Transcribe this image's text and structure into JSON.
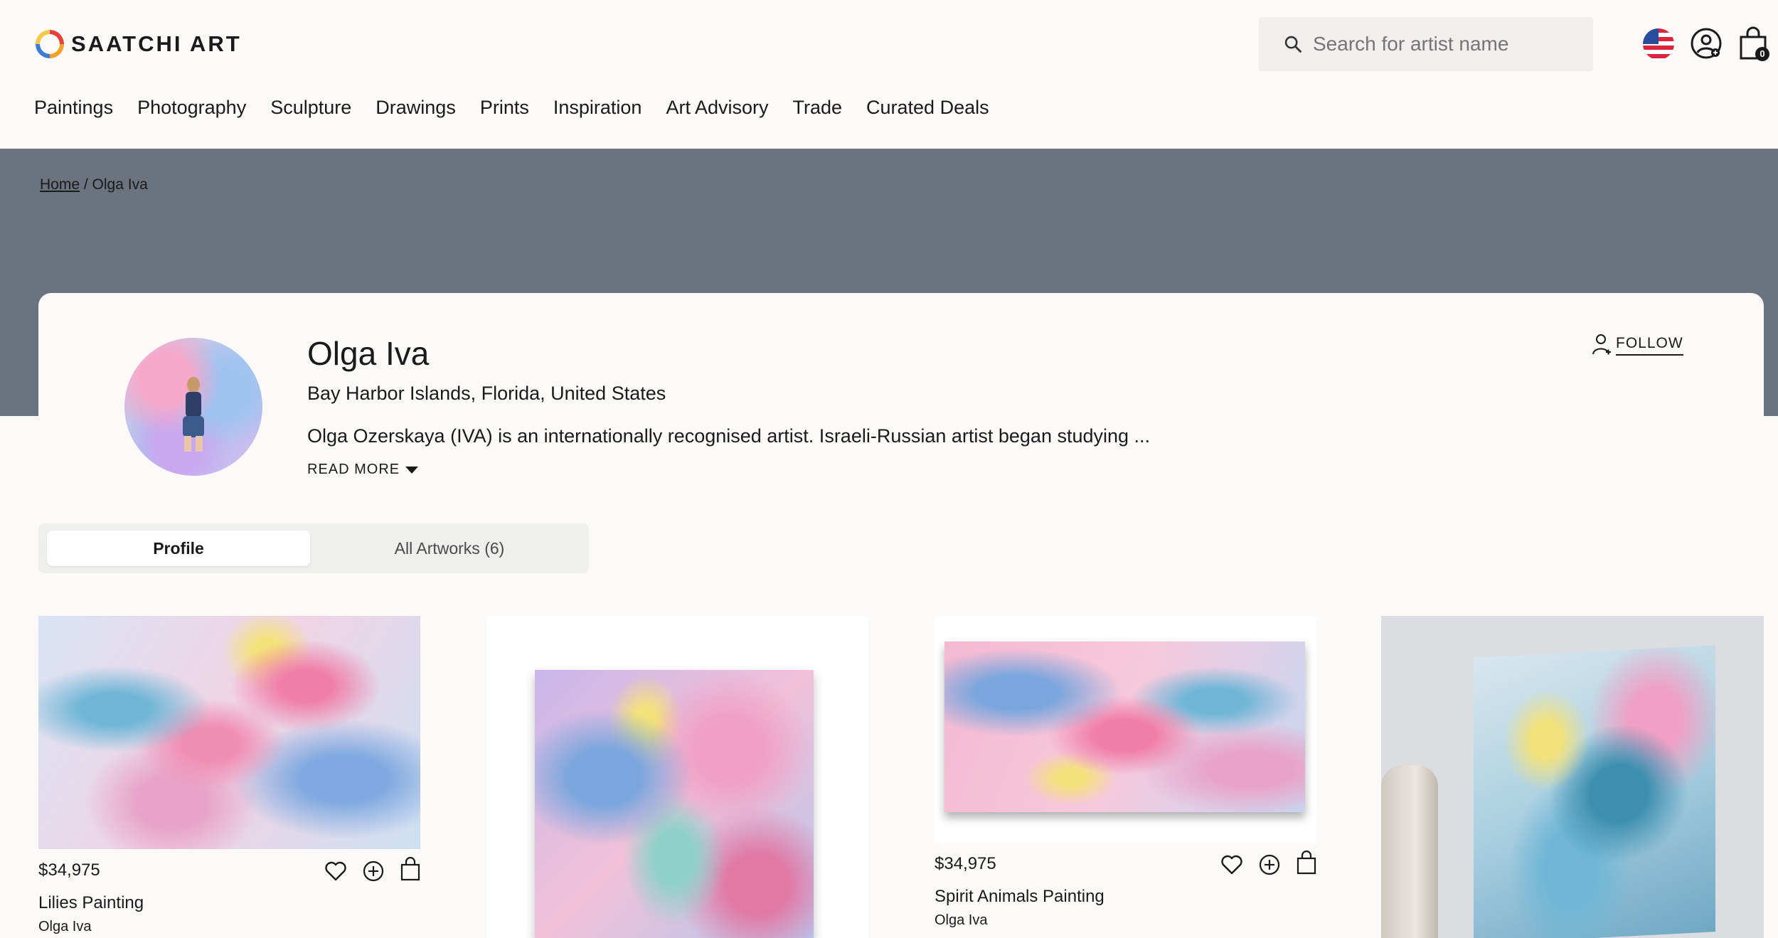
{
  "brand": {
    "name": "SAATCHI ART"
  },
  "search": {
    "placeholder": "Search for artist name"
  },
  "cart": {
    "count": "0"
  },
  "nav": [
    "Paintings",
    "Photography",
    "Sculpture",
    "Drawings",
    "Prints",
    "Inspiration",
    "Art Advisory",
    "Trade",
    "Curated Deals"
  ],
  "breadcrumb": {
    "home": "Home",
    "separator": " / ",
    "current": "Olga Iva"
  },
  "profile": {
    "name": "Olga Iva",
    "location": "Bay Harbor Islands, Florida, United States",
    "bio": "Olga Ozerskaya (IVA) is an internationally recognised artist. Israeli-Russian artist began studying ...",
    "read_more": "READ MORE",
    "follow": "FOLLOW"
  },
  "tabs": {
    "profile": "Profile",
    "artworks": "All Artworks (6)"
  },
  "artworks": [
    {
      "price": "$34,975",
      "title": "Lilies Painting",
      "artist": "Olga Iva"
    },
    {
      "price": "",
      "title": "",
      "artist": ""
    },
    {
      "price": "$34,975",
      "title": "Spirit Animals Painting",
      "artist": "Olga Iva"
    },
    {
      "price": "",
      "title": "",
      "artist": ""
    }
  ],
  "colors": {
    "banner": "#6b737f",
    "background": "#fbfaf8",
    "text": "#1a1a1a",
    "tab_bg": "#efefee"
  }
}
